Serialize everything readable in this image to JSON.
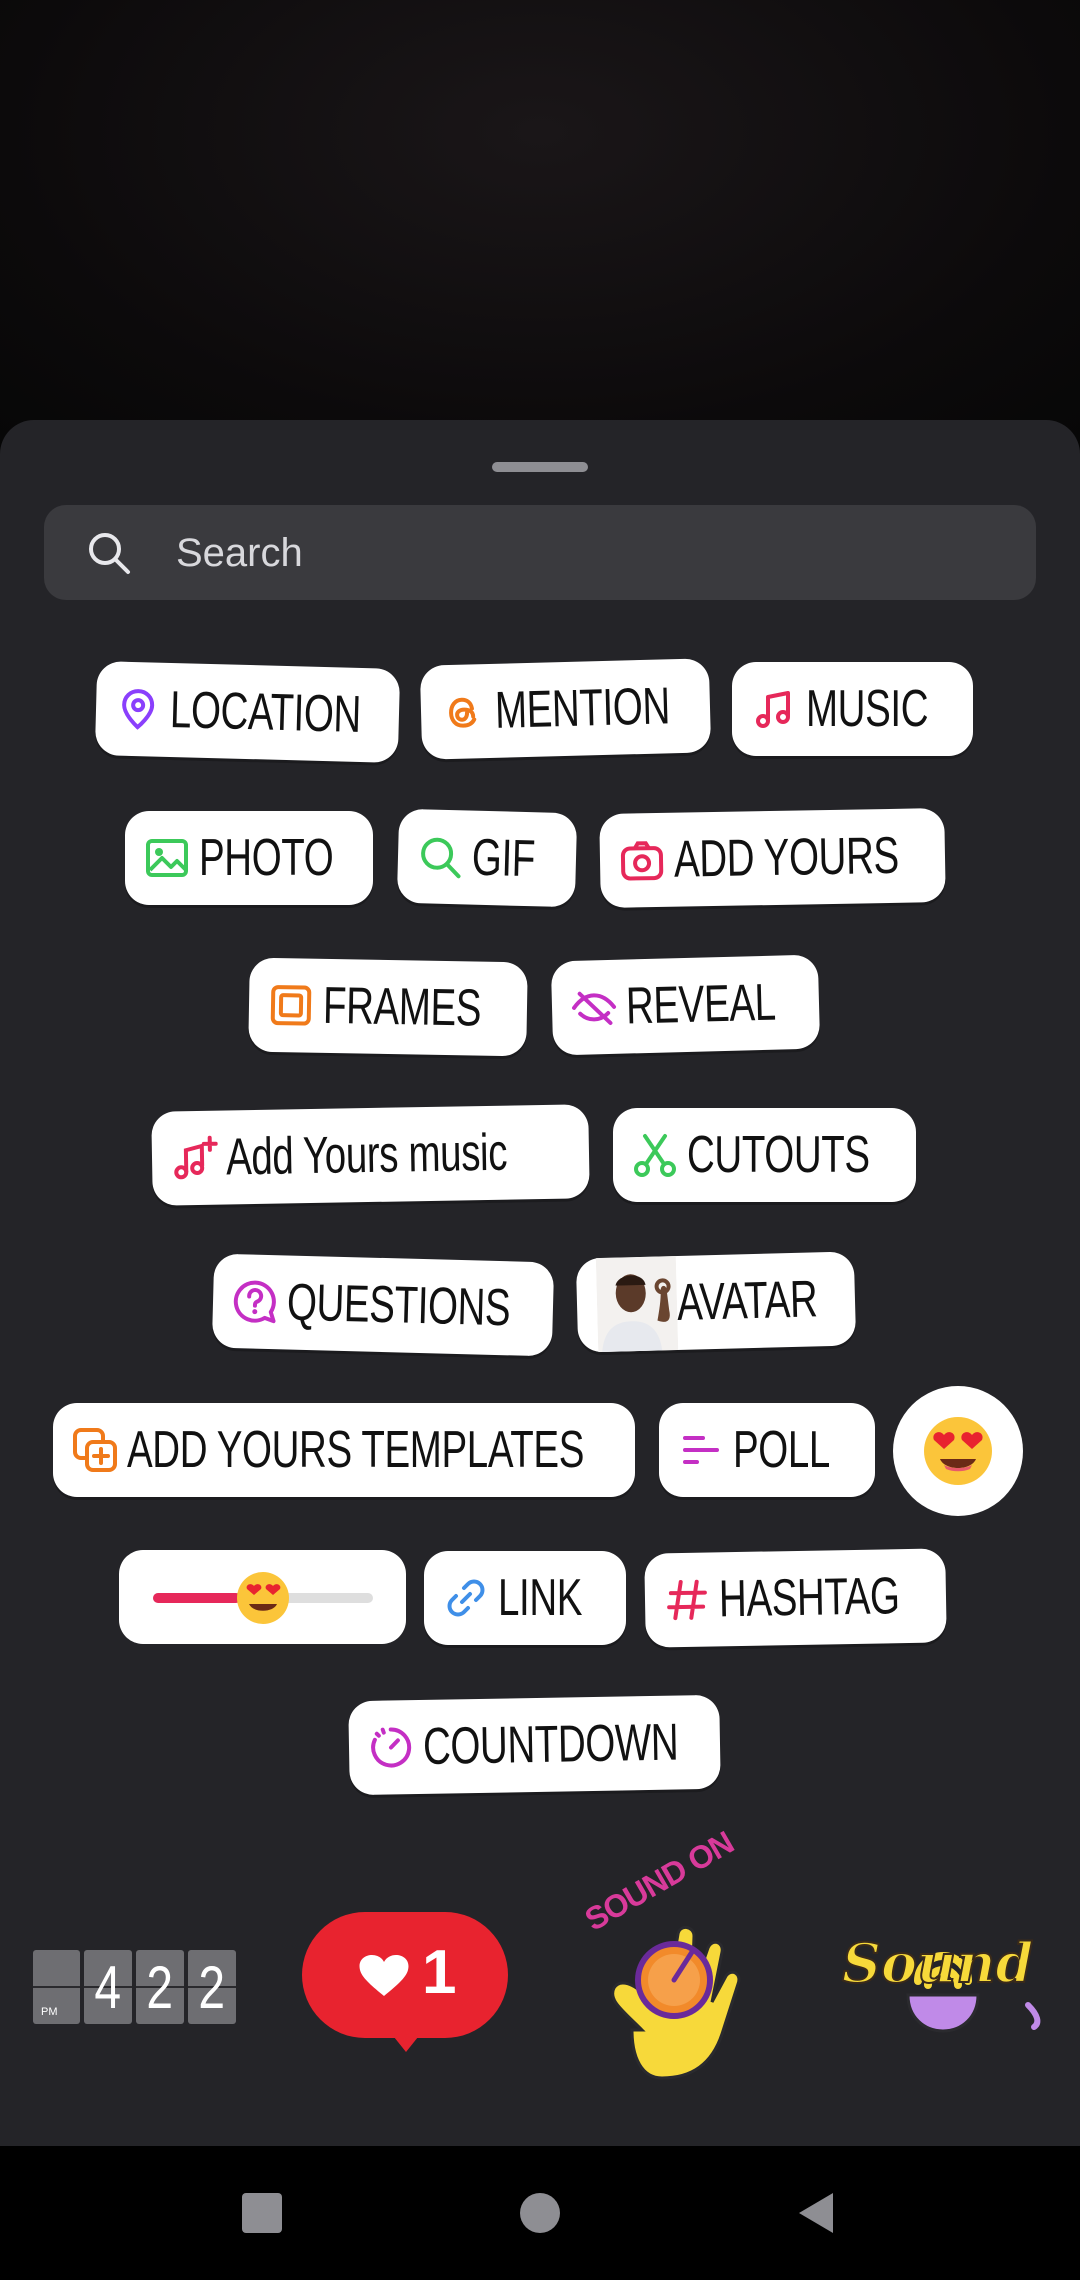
{
  "search": {
    "placeholder": "Search"
  },
  "stickers": {
    "location": "LOCATION",
    "mention": "MENTION",
    "music": "MUSIC",
    "photo": "PHOTO",
    "gif": "GIF",
    "add_yours": "ADD YOURS",
    "frames": "FRAMES",
    "reveal": "REVEAL",
    "add_yours_music": "Add Yours music",
    "cutouts": "CUTOUTS",
    "questions": "QUESTIONS",
    "avatar": "AVATAR",
    "add_yours_templates": "ADD YOURS TEMPLATES",
    "poll": "POLL",
    "link": "LINK",
    "hashtag": "HASHTAG",
    "countdown": "COUNTDOWN"
  },
  "emoji_slider": {
    "value": 0.4,
    "emoji": "heart-eyes"
  },
  "clock_sticker": {
    "period": "PM",
    "digits": [
      "4",
      "2",
      "2"
    ]
  },
  "likes_sticker": {
    "count": "1"
  },
  "sound_on_sticker": {
    "text": "SOUND ON"
  },
  "sound_sticker": {
    "text": "Sound"
  },
  "colors": {
    "sheet": "#242428",
    "search_bg": "#3a3a3e",
    "purple": "#8a3ffc",
    "orange": "#f07a1a",
    "pink": "#e6285a",
    "green": "#3cc95a",
    "magenta": "#c42fc4",
    "blue": "#3f8fe8",
    "likes_red": "#e8232f"
  },
  "nav": {
    "square": "recents-icon",
    "circle": "home-icon",
    "triangle": "back-icon"
  }
}
